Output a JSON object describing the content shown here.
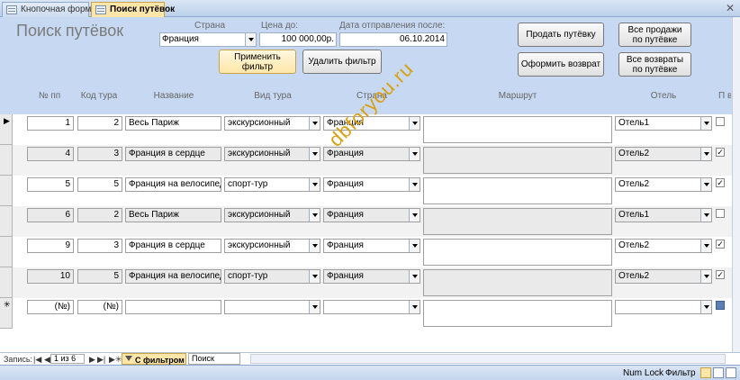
{
  "tabs": [
    {
      "label": "Кнопочная форма"
    },
    {
      "label": "Поиск путёвок",
      "active": true
    }
  ],
  "form": {
    "title": "Поиск путёвок",
    "filters": {
      "country": {
        "label": "Страна",
        "value": "Франция"
      },
      "price": {
        "label": "Цена до:",
        "value": "100 000,00р."
      },
      "date": {
        "label": "Дата отправления после:",
        "value": "06.10.2014"
      }
    },
    "buttons": {
      "apply_filter": "Применить фильтр",
      "remove_filter": "Удалить фильтр",
      "sell": "Продать путёвку",
      "return": "Оформить возврат",
      "all_sales": "Все продажи по путёвке",
      "all_returns": "Все возвраты по путёвке"
    }
  },
  "columns": [
    "№ пп",
    "Код тура",
    "Название",
    "Вид тура",
    "Страна",
    "Маршрут",
    "Отель",
    "П вн"
  ],
  "rows": [
    {
      "num": "1",
      "code": "2",
      "name": "Весь Париж",
      "type": "экскурсионный",
      "country": "Франция",
      "route": "",
      "hotel": "Отель1",
      "checked": false
    },
    {
      "num": "4",
      "code": "3",
      "name": "Франция в сердце",
      "type": "экскурсионный",
      "country": "Франция",
      "route": "",
      "hotel": "Отель2",
      "checked": true
    },
    {
      "num": "5",
      "code": "5",
      "name": "Франция на велосипеде",
      "type": "спорт-тур",
      "country": "Франция",
      "route": "",
      "hotel": "Отель2",
      "checked": true
    },
    {
      "num": "6",
      "code": "2",
      "name": "Весь Париж",
      "type": "экскурсионный",
      "country": "Франция",
      "route": "",
      "hotel": "Отель1",
      "checked": false
    },
    {
      "num": "9",
      "code": "3",
      "name": "Франция в сердце",
      "type": "экскурсионный",
      "country": "Франция",
      "route": "",
      "hotel": "Отель2",
      "checked": true
    },
    {
      "num": "10",
      "code": "5",
      "name": "Франция на велосипеде",
      "type": "спорт-тур",
      "country": "Франция",
      "route": "",
      "hotel": "Отель2",
      "checked": true
    }
  ],
  "new_row": {
    "num": "(№)",
    "code": "(№)"
  },
  "navigation": {
    "label": "Запись:",
    "current": "1 из 6",
    "filter_label": "С фильтром",
    "search_placeholder": "Поиск"
  },
  "status": {
    "numlock": "Num Lock",
    "filter": "Фильтр"
  },
  "watermark": "dbforyou.ru",
  "colors": {
    "header_bg": "#c7d9f2",
    "active_tab": "#fde6a8",
    "watermark": "#d9a011"
  }
}
